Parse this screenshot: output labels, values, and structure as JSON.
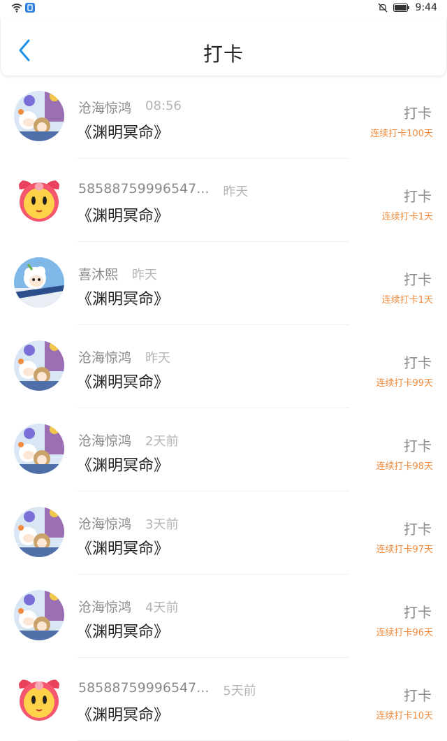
{
  "status_bar": {
    "time": "9:44",
    "left_icons": [
      "wifi-icon",
      "app-badge-icon"
    ],
    "right_icons": [
      "mute-icon",
      "battery-icon"
    ]
  },
  "header": {
    "title": "打卡",
    "back_icon": "chevron-left-icon",
    "accent_color": "#1e90e8"
  },
  "rows": [
    {
      "avatar": "avatar-sheep-group",
      "name": "沧海惊鸿",
      "time": "08:56",
      "book": "《渊明冥命》",
      "action": "打卡",
      "streak": "连续打卡100天"
    },
    {
      "avatar": "avatar-pink-face",
      "name": "58588759996547...",
      "time": "昨天",
      "book": "《渊明冥命》",
      "action": "打卡",
      "streak": "连续打卡1天"
    },
    {
      "avatar": "avatar-white-sheep",
      "name": "喜沐熙",
      "time": "昨天",
      "book": "《渊明冥命》",
      "action": "打卡",
      "streak": "连续打卡1天"
    },
    {
      "avatar": "avatar-sheep-group",
      "name": "沧海惊鸿",
      "time": "昨天",
      "book": "《渊明冥命》",
      "action": "打卡",
      "streak": "连续打卡99天"
    },
    {
      "avatar": "avatar-sheep-group",
      "name": "沧海惊鸿",
      "time": "2天前",
      "book": "《渊明冥命》",
      "action": "打卡",
      "streak": "连续打卡98天"
    },
    {
      "avatar": "avatar-sheep-group",
      "name": "沧海惊鸿",
      "time": "3天前",
      "book": "《渊明冥命》",
      "action": "打卡",
      "streak": "连续打卡97天"
    },
    {
      "avatar": "avatar-sheep-group",
      "name": "沧海惊鸿",
      "time": "4天前",
      "book": "《渊明冥命》",
      "action": "打卡",
      "streak": "连续打卡96天"
    },
    {
      "avatar": "avatar-pink-face",
      "name": "58588759996547...",
      "time": "5天前",
      "book": "《渊明冥命》",
      "action": "打卡",
      "streak": "连续打卡10天"
    }
  ],
  "colors": {
    "streak": "#f08a3c",
    "muted_text": "#8a8a8a"
  }
}
